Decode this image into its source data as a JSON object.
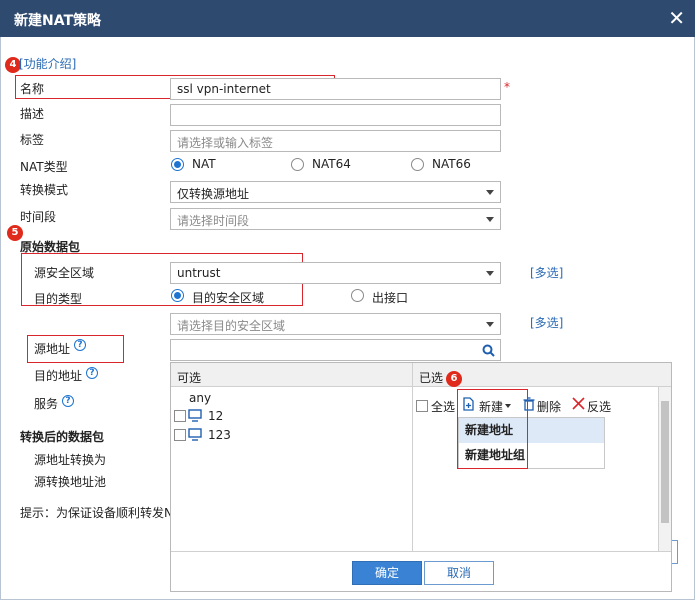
{
  "dialog": {
    "title": "新建NAT策略",
    "close_icon": "close-icon"
  },
  "help_link": "[功能介绍]",
  "markers": {
    "m4": "4",
    "m5": "5",
    "m6": "6"
  },
  "form": {
    "name_label": "名称",
    "name_value": "ssl vpn-internet",
    "required_mark": "*",
    "desc_label": "描述",
    "tag_label": "标签",
    "tag_placeholder": "请选择或输入标签",
    "nat_type_label": "NAT类型",
    "nat_options": [
      "NAT",
      "NAT64",
      "NAT66"
    ],
    "nat_selected": "NAT",
    "mode_label": "转换模式",
    "mode_value": "仅转换源地址",
    "time_label": "时间段",
    "time_placeholder": "请选择时间段"
  },
  "original": {
    "section_title": "原始数据包",
    "src_zone_label": "源安全区域",
    "src_zone_value": "untrust",
    "multi_link": "[多选]",
    "dst_type_label": "目的类型",
    "dst_type_options": [
      "目的安全区域",
      "出接口"
    ],
    "dst_type_selected": "目的安全区域",
    "dst_zone_placeholder": "请选择目的安全区域",
    "multi_link_2": "[多选]",
    "src_addr_label": "源地址",
    "dst_addr_label": "目的地址",
    "service_label": "服务"
  },
  "translated": {
    "section_title": "转换后的数据包",
    "src_translate_label": "源地址转换为",
    "src_pool_label": "源转换地址池"
  },
  "hint": "提示：为保证设备顺利转发N",
  "picker": {
    "available_header": "可选",
    "selected_header": "已选",
    "available_items": [
      "any",
      "12",
      "123"
    ],
    "select_all": "全选",
    "new_label": "新建",
    "delete_label": "删除",
    "invert_label": "反选",
    "new_menu": [
      "新建地址",
      "新建地址组"
    ],
    "ok_label": "确定",
    "cancel_label": "取消"
  },
  "colors": {
    "titlebar": "#2e4a6f",
    "accent": "#3a83d4",
    "marker": "#e02a1c"
  }
}
